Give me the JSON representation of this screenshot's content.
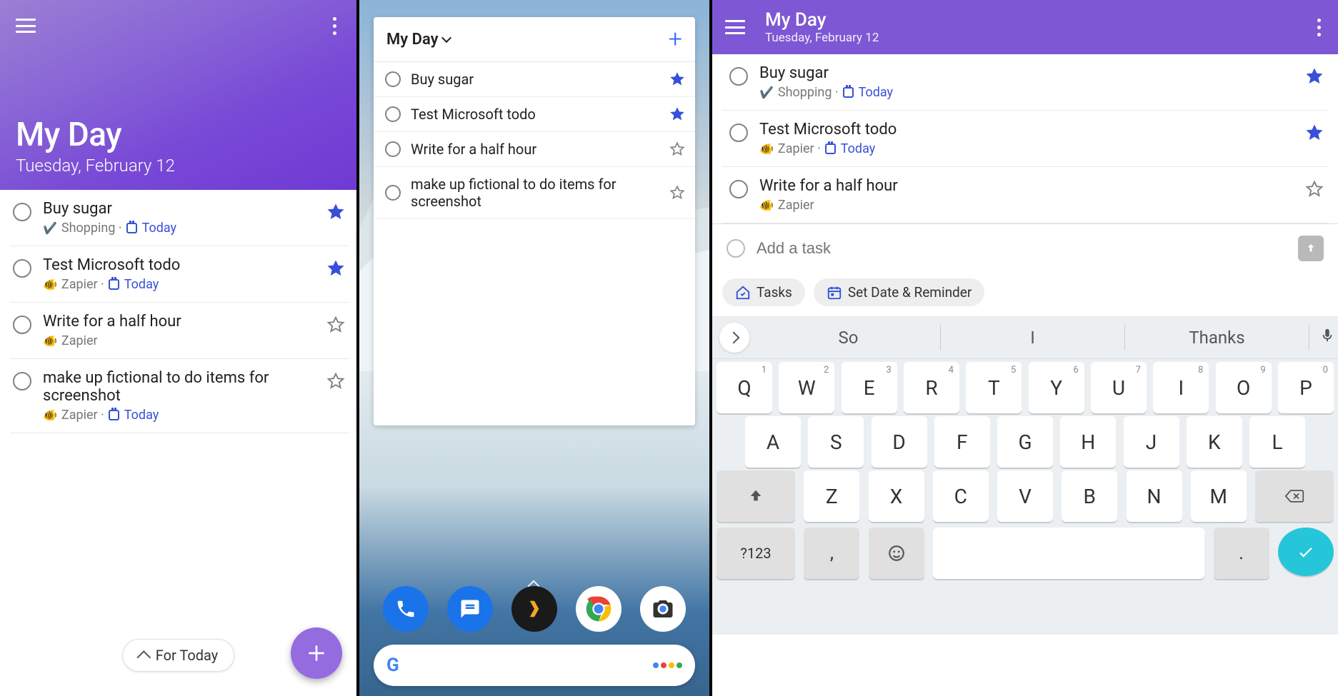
{
  "panel1": {
    "title": "My Day",
    "date": "Tuesday, February 12",
    "tasks": [
      {
        "title": "Buy sugar",
        "listEmoji": "✔️",
        "list": "Shopping",
        "hasDue": true,
        "due": "Today",
        "starred": true
      },
      {
        "title": "Test Microsoft todo",
        "listEmoji": "🐠",
        "list": "Zapier",
        "hasDue": true,
        "due": "Today",
        "starred": true
      },
      {
        "title": "Write for a half hour",
        "listEmoji": "🐠",
        "list": "Zapier",
        "hasDue": false,
        "due": "",
        "starred": false
      },
      {
        "title": "make up fictional to do items for screenshot",
        "listEmoji": "🐠",
        "list": "Zapier",
        "hasDue": true,
        "due": "Today",
        "starred": false
      }
    ],
    "forTodayLabel": "For Today"
  },
  "panel2": {
    "widgetTitle": "My Day",
    "tasks": [
      {
        "title": "Buy sugar",
        "starred": true
      },
      {
        "title": "Test Microsoft todo",
        "starred": true
      },
      {
        "title": "Write for a half hour",
        "starred": false
      },
      {
        "title": "make up fictional to do items for screenshot",
        "starred": false
      }
    ],
    "dock": [
      "phone",
      "messages",
      "plex",
      "chrome",
      "camera"
    ]
  },
  "panel3": {
    "title": "My Day",
    "date": "Tuesday, February 12",
    "tasks": [
      {
        "title": "Buy sugar",
        "listEmoji": "✔️",
        "list": "Shopping",
        "hasDue": true,
        "due": "Today",
        "starred": true
      },
      {
        "title": "Test Microsoft todo",
        "listEmoji": "🐠",
        "list": "Zapier",
        "hasDue": true,
        "due": "Today",
        "starred": true
      },
      {
        "title": "Write for a half hour",
        "listEmoji": "🐠",
        "list": "Zapier",
        "hasDue": false,
        "due": "",
        "starred": false
      }
    ],
    "addPlaceholder": "Add a task",
    "chips": {
      "tasks": "Tasks",
      "setDate": "Set Date & Reminder"
    },
    "suggestions": [
      "So",
      "I",
      "Thanks"
    ],
    "keyboard": {
      "row1": [
        "Q",
        "W",
        "E",
        "R",
        "T",
        "Y",
        "U",
        "I",
        "O",
        "P"
      ],
      "row1nums": [
        "1",
        "2",
        "3",
        "4",
        "5",
        "6",
        "7",
        "8",
        "9",
        "0"
      ],
      "row2": [
        "A",
        "S",
        "D",
        "F",
        "G",
        "H",
        "J",
        "K",
        "L"
      ],
      "row3": [
        "Z",
        "X",
        "C",
        "V",
        "B",
        "N",
        "M"
      ],
      "symKey": "?123",
      "comma": ",",
      "dot": "."
    }
  }
}
